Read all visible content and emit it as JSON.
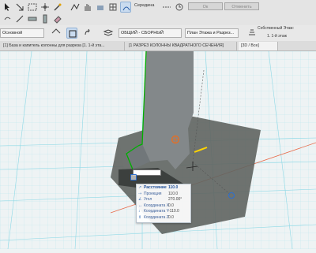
{
  "toolbar1": {
    "arc_label": "Середина",
    "ok_label": "Ок",
    "cancel_label": "Отменить"
  },
  "toolbar2": {
    "layer_combo": "Основной",
    "structure_combo": "ОБЩИЙ - СБОРНЫЙ",
    "view_combo": "План Этажа и Разрез...",
    "story_label": "Собственный Этаж:",
    "story_value": "1. 1-й этаж"
  },
  "tabs": [
    {
      "label": "[1] База и капитель колонны для разреза [1. 1-й эта..."
    },
    {
      "label": "[1 РАЗРЕЗ КОЛОННЫ КВАДРАТНОГО СЕЧЕНИЯ]"
    },
    {
      "label": "[3D / Все]"
    }
  ],
  "tracker": [
    {
      "icon": "↗",
      "label": "Расстояние",
      "value": "110.0",
      "bold": true
    },
    {
      "icon": "⇢",
      "label": "Проекция",
      "value": "110.0",
      "bold": false
    },
    {
      "icon": "∠",
      "label": "Угол",
      "value": "270.00°",
      "bold": false
    },
    {
      "icon": "↔",
      "label": "Координата X",
      "value": "0.0",
      "bold": false
    },
    {
      "icon": "↕",
      "label": "Координата Y",
      "value": "-110.0",
      "bold": false
    },
    {
      "icon": "⇕",
      "label": "Координата Z",
      "value": "0.0",
      "bold": false
    }
  ],
  "colors": {
    "grid": "#7fd8e6",
    "column": "#7f8480",
    "slab": "#5e625f",
    "accent": "#3a6fb5",
    "selection": "#ffd400"
  },
  "icons": [
    "pointer-icon",
    "arrow-icon",
    "marquee-icon",
    "wand-icon",
    "polyline-icon",
    "arc-icon",
    "rect-icon",
    "rotate-icon",
    "layers-icon",
    "view-icon"
  ]
}
